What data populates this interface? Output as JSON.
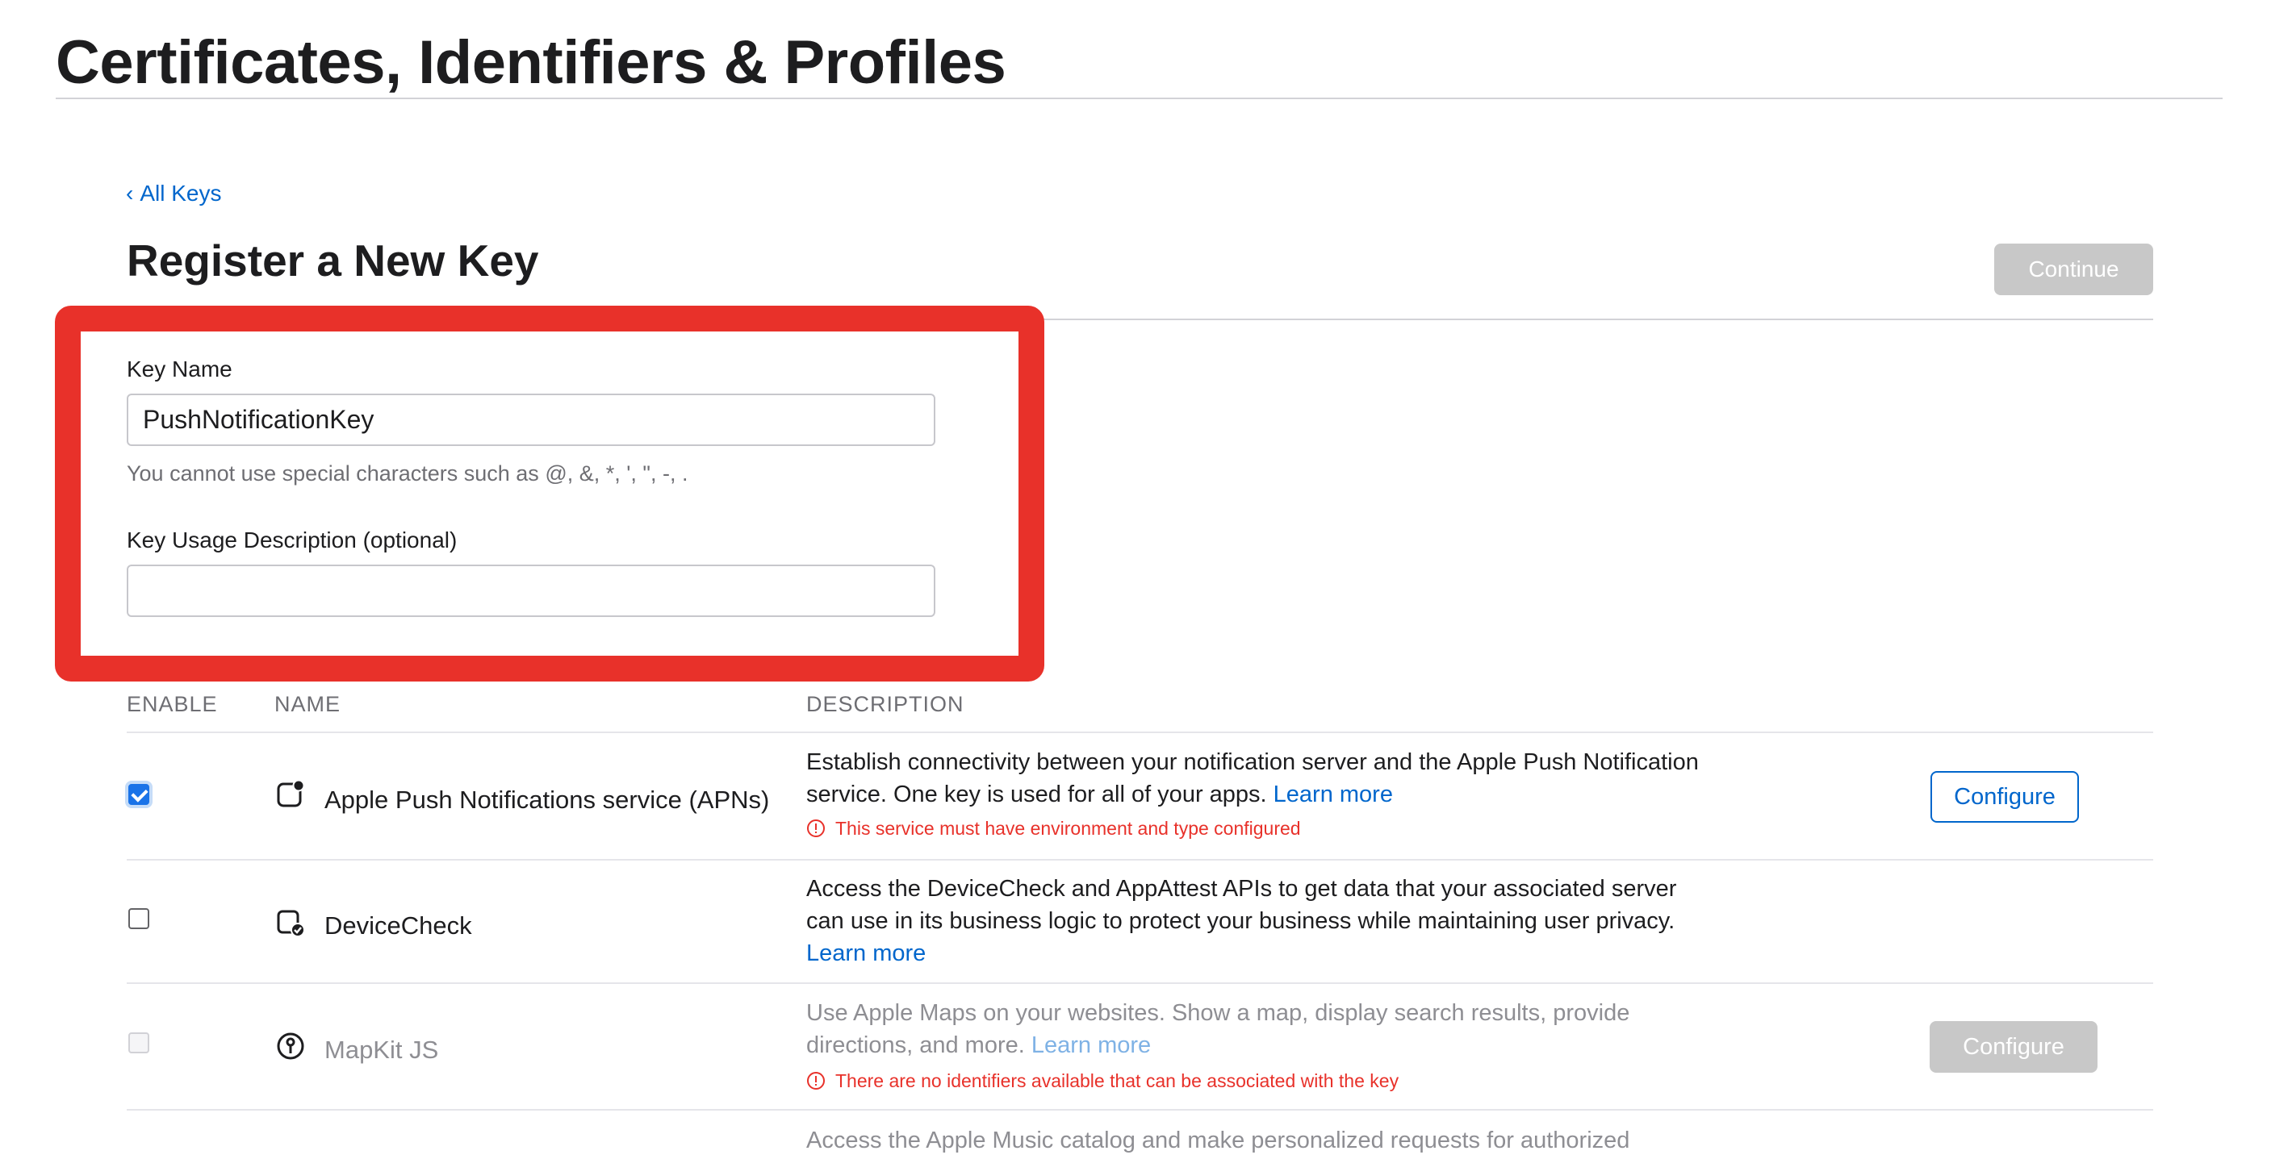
{
  "header": {
    "title": "Certificates, Identifiers & Profiles"
  },
  "nav": {
    "back_chevron": "‹",
    "back_label": "All Keys"
  },
  "page": {
    "subtitle": "Register a New Key",
    "continue_label": "Continue"
  },
  "form": {
    "key_name_label": "Key Name",
    "key_name_value": "PushNotificationKey",
    "key_name_hint": "You cannot use special characters such as @, &, *, ', \", -, .",
    "description_label": "Key Usage Description (optional)",
    "description_value": ""
  },
  "table": {
    "headers": {
      "enable": "ENABLE",
      "name": "NAME",
      "description": "DESCRIPTION"
    },
    "rows": [
      {
        "name": "Apple Push Notifications service (APNs)",
        "icon": "notification-badge-icon",
        "checked": true,
        "description": "Establish connectivity between your notification server and the Apple Push Notification service. One key is used for all of your apps.",
        "learn_more": "Learn more",
        "warning": "This service must have environment and type configured",
        "action": "Configure"
      },
      {
        "name": "DeviceCheck",
        "icon": "device-check-icon",
        "checked": false,
        "description": "Access the DeviceCheck and AppAttest APIs to get data that your associated server can use in its business logic to protect your business while maintaining user privacy.",
        "learn_more": "Learn more"
      },
      {
        "name": "MapKit JS",
        "icon": "map-pin-icon",
        "checked": false,
        "disabled": true,
        "description": "Use Apple Maps on your websites. Show a map, display search results, provide directions, and more.",
        "learn_more": "Learn more",
        "warning": "There are no identifiers available that can be associated with the key",
        "action": "Configure"
      },
      {
        "description": "Access the Apple Music catalog and make personalized requests for authorized"
      }
    ]
  },
  "colors": {
    "accent": "#0066cc",
    "highlight": "#e8312a",
    "warning": "#e8312a",
    "disabled": "#c8c8c8"
  }
}
